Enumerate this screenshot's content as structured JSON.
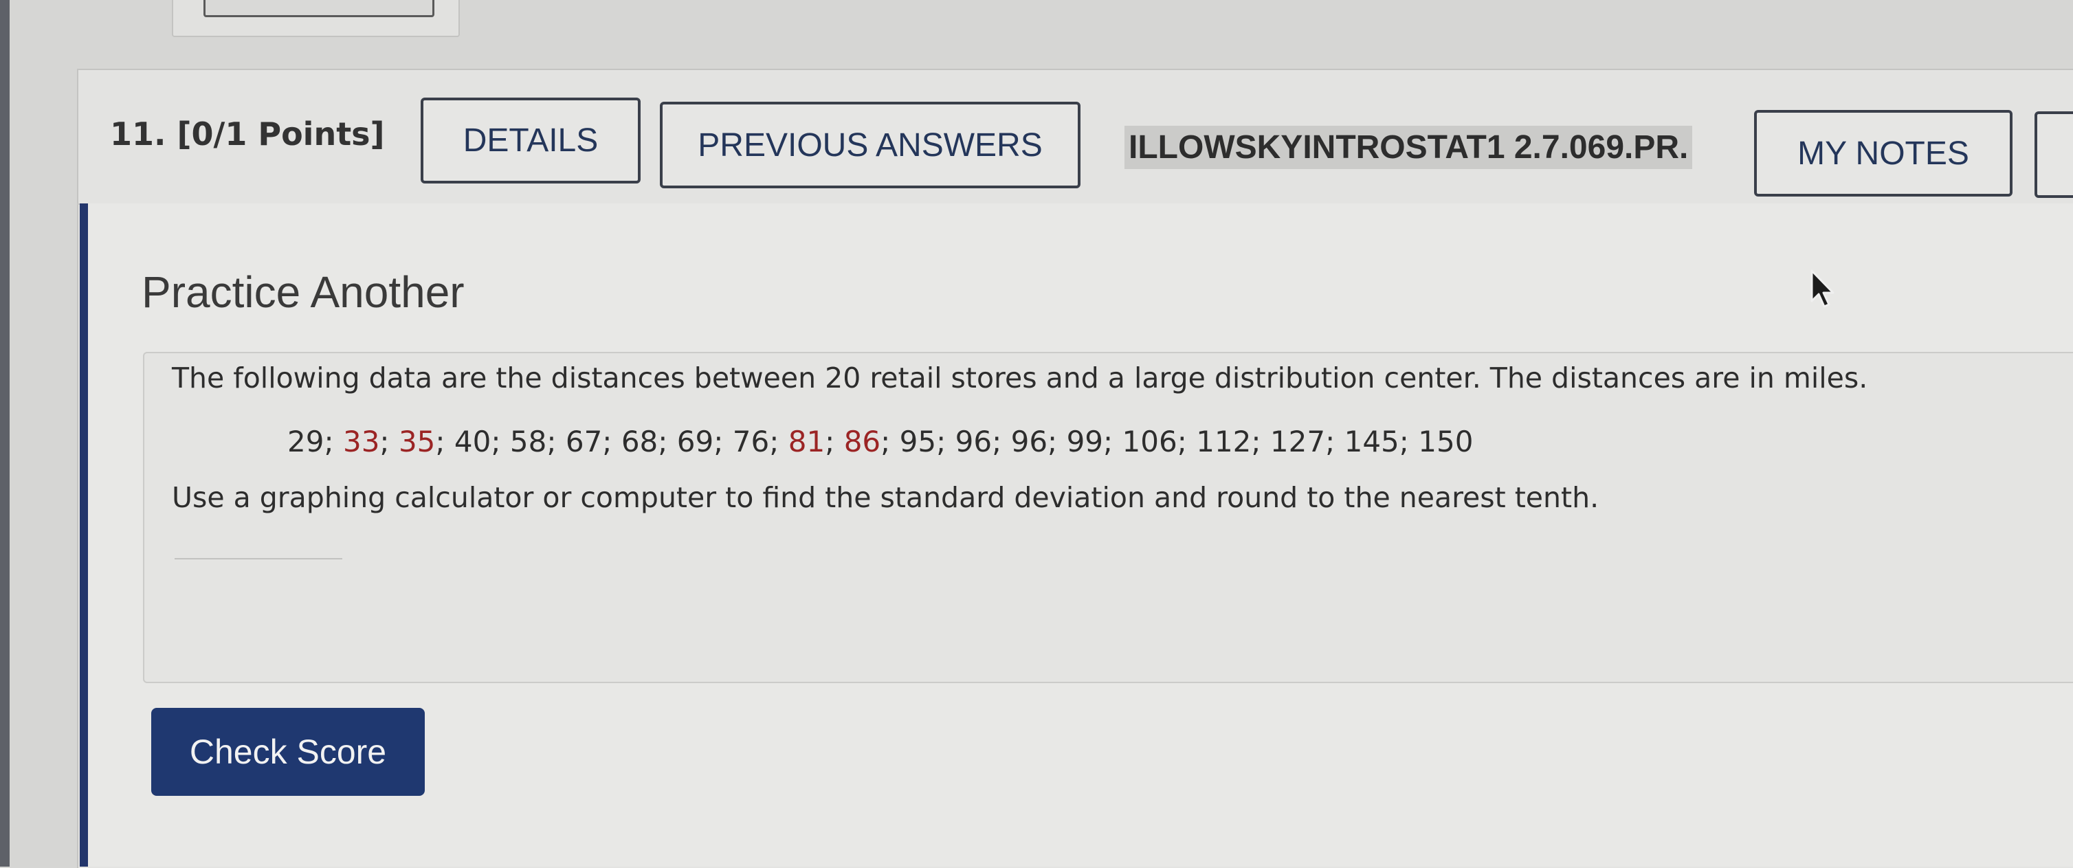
{
  "header": {
    "points_label": "11. [0/1 Points]",
    "details_label": "DETAILS",
    "previous_answers_label": "PREVIOUS ANSWERS",
    "problem_id": "ILLOWSKYINTROSTAT1 2.7.069.PR.",
    "my_notes_label": "MY NOTES"
  },
  "main": {
    "practice_title": "Practice Another",
    "problem_text": "The following data are the distances between 20 retail stores and a large distribution center. The distances are in miles.",
    "data_values": [
      {
        "v": "29",
        "c": "#2d2d2d"
      },
      {
        "v": "33",
        "c": "#9b2424"
      },
      {
        "v": "35",
        "c": "#9b2424"
      },
      {
        "v": "40",
        "c": "#2d2d2d"
      },
      {
        "v": "58",
        "c": "#2d2d2d"
      },
      {
        "v": "67",
        "c": "#2d2d2d"
      },
      {
        "v": "68",
        "c": "#2d2d2d"
      },
      {
        "v": "69",
        "c": "#2d2d2d"
      },
      {
        "v": "76",
        "c": "#2d2d2d"
      },
      {
        "v": "81",
        "c": "#9b2424"
      },
      {
        "v": "86",
        "c": "#9b2424"
      },
      {
        "v": "95",
        "c": "#2d2d2d"
      },
      {
        "v": "96",
        "c": "#2d2d2d"
      },
      {
        "v": "96",
        "c": "#2d2d2d"
      },
      {
        "v": "99",
        "c": "#2d2d2d"
      },
      {
        "v": "106",
        "c": "#2d2d2d"
      },
      {
        "v": "112",
        "c": "#2d2d2d"
      },
      {
        "v": "127",
        "c": "#2d2d2d"
      },
      {
        "v": "145",
        "c": "#2d2d2d"
      },
      {
        "v": "150",
        "c": "#2d2d2d"
      }
    ],
    "data_separator": "; ",
    "instruction_text": "Use a graphing calculator or computer to find the standard deviation and round to the nearest tenth.",
    "answer_value": "",
    "check_score_label": "Check Score"
  },
  "colors": {
    "accent_navy": "#1f3870",
    "highlight_red": "#9b2424",
    "page_bg": "#d6d6d4"
  },
  "icons": {
    "cursor": "mouse-pointer-icon"
  }
}
